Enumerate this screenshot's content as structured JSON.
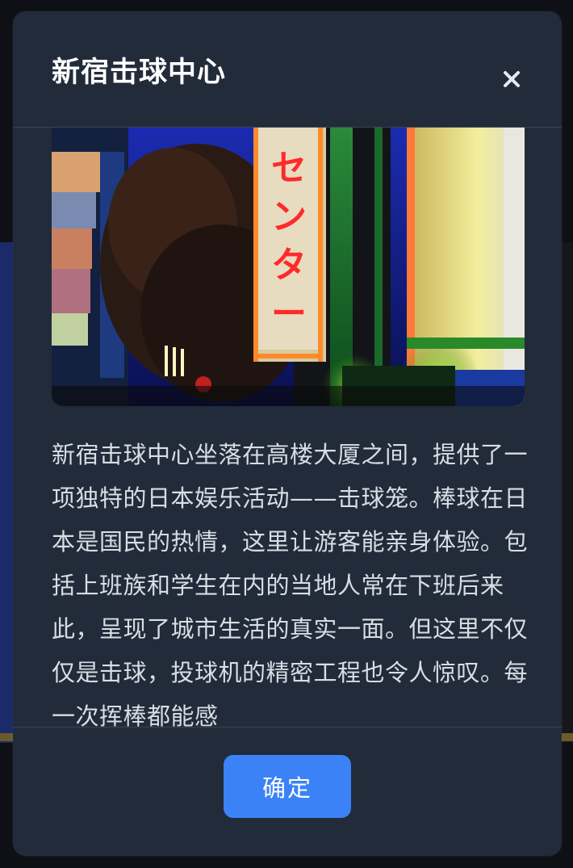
{
  "modal": {
    "title": "新宿击球中心",
    "close_icon": "close-icon",
    "image": {
      "subject": "neon-sign-street-scene",
      "sign_text": "センター"
    },
    "description": "新宿击球中心坐落在高楼大厦之间，提供了一项独特的日本娱乐活动——击球笼。棒球在日本是国民的热情，这里让游客能亲身体验。包括上班族和学生在内的当地人常在下班后来此，呈现了城市生活的真实一面。但这里不仅仅是击球，投球机的精密工程也令人惊叹。每一次挥棒都能感",
    "confirm_label": "确定"
  },
  "colors": {
    "modal_bg": "#222b3a",
    "accent": "#3b82f6",
    "text": "#d9dde4",
    "title": "#ffffff"
  }
}
